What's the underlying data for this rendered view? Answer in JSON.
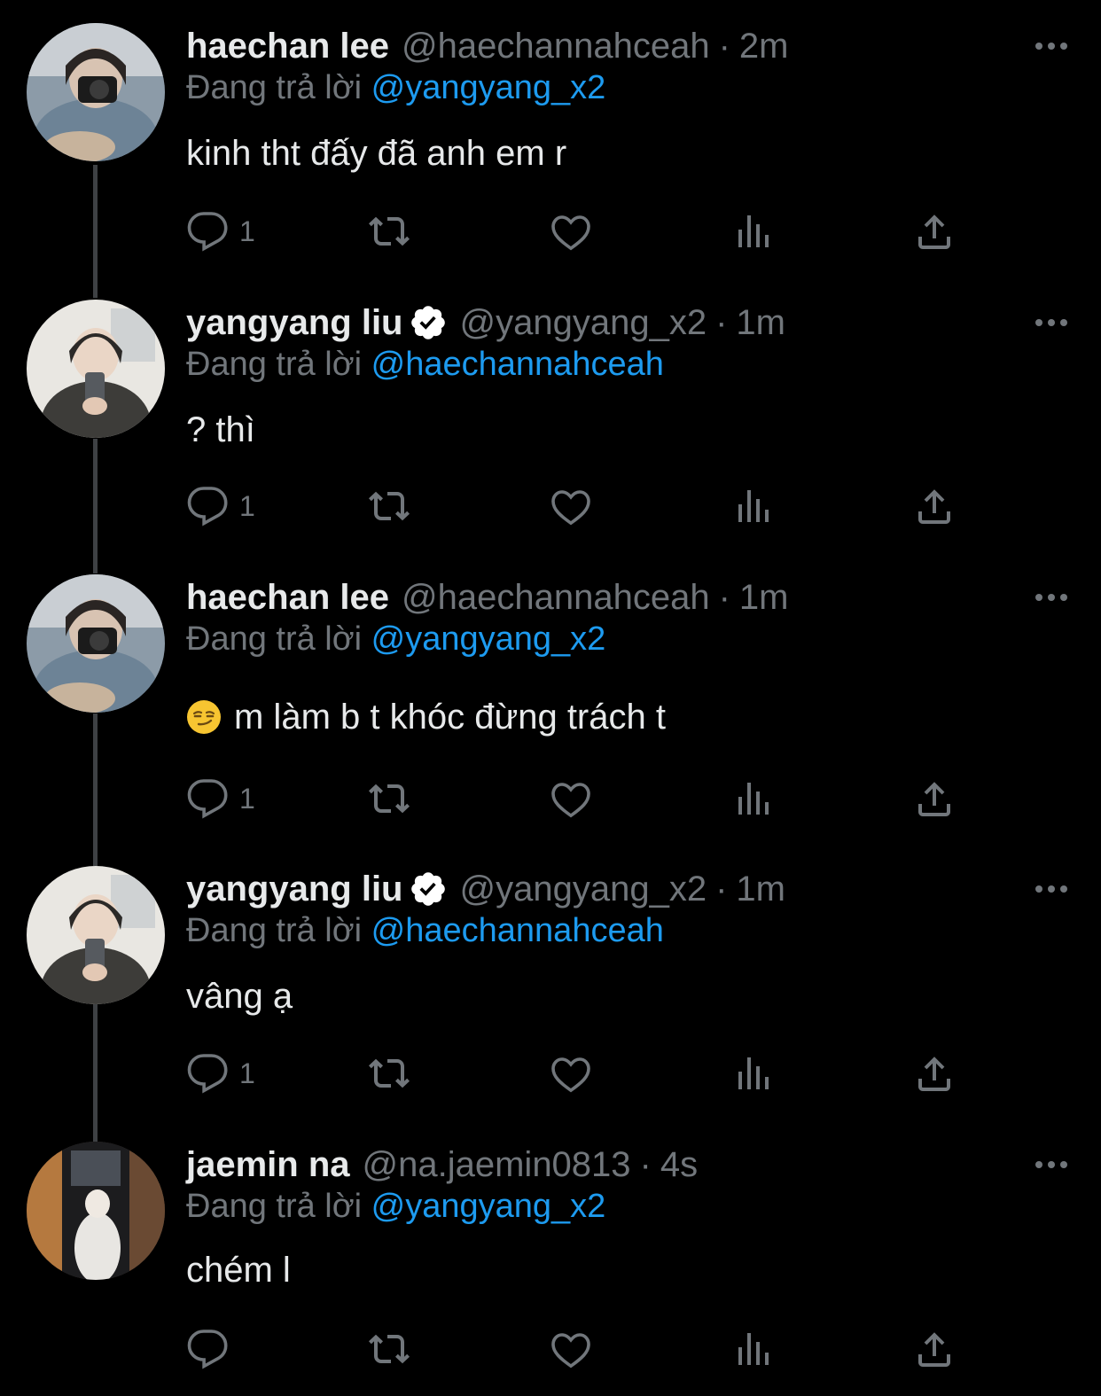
{
  "reply_prefix": "Đang trả lời",
  "tweets": [
    {
      "name": "haechan lee",
      "verified": false,
      "handle": "@haechannahceah",
      "time": "2m",
      "reply_to": "@yangyang_x2",
      "text": "kinh tht đấy đã anh em r",
      "emoji": "",
      "reply_count": "1"
    },
    {
      "name": "yangyang liu",
      "verified": true,
      "handle": "@yangyang_x2",
      "time": "1m",
      "reply_to": "@haechannahceah",
      "text": "? thì",
      "emoji": "",
      "reply_count": "1"
    },
    {
      "name": "haechan lee",
      "verified": false,
      "handle": "@haechannahceah",
      "time": "1m",
      "reply_to": "@yangyang_x2",
      "text": "m làm b t khóc đừng trách t",
      "emoji": "smirking-face",
      "reply_count": "1"
    },
    {
      "name": "yangyang liu",
      "verified": true,
      "handle": "@yangyang_x2",
      "time": "1m",
      "reply_to": "@haechannahceah",
      "text": "vâng ạ",
      "emoji": "",
      "reply_count": "1"
    },
    {
      "name": "jaemin na",
      "verified": false,
      "handle": "@na.jaemin0813",
      "time": "4s",
      "reply_to": "@yangyang_x2",
      "text": "chém l",
      "emoji": "",
      "reply_count": ""
    }
  ],
  "colors": {
    "background": "#000000",
    "text": "#e7e9ea",
    "muted": "#71767b",
    "accent": "#1d9bf0",
    "thread_line": "#3e4144"
  },
  "icons": [
    "reply-icon",
    "retweet-icon",
    "like-icon",
    "views-icon",
    "share-icon",
    "more-icon",
    "verified-badge-icon",
    "smirking-face-emoji"
  ]
}
